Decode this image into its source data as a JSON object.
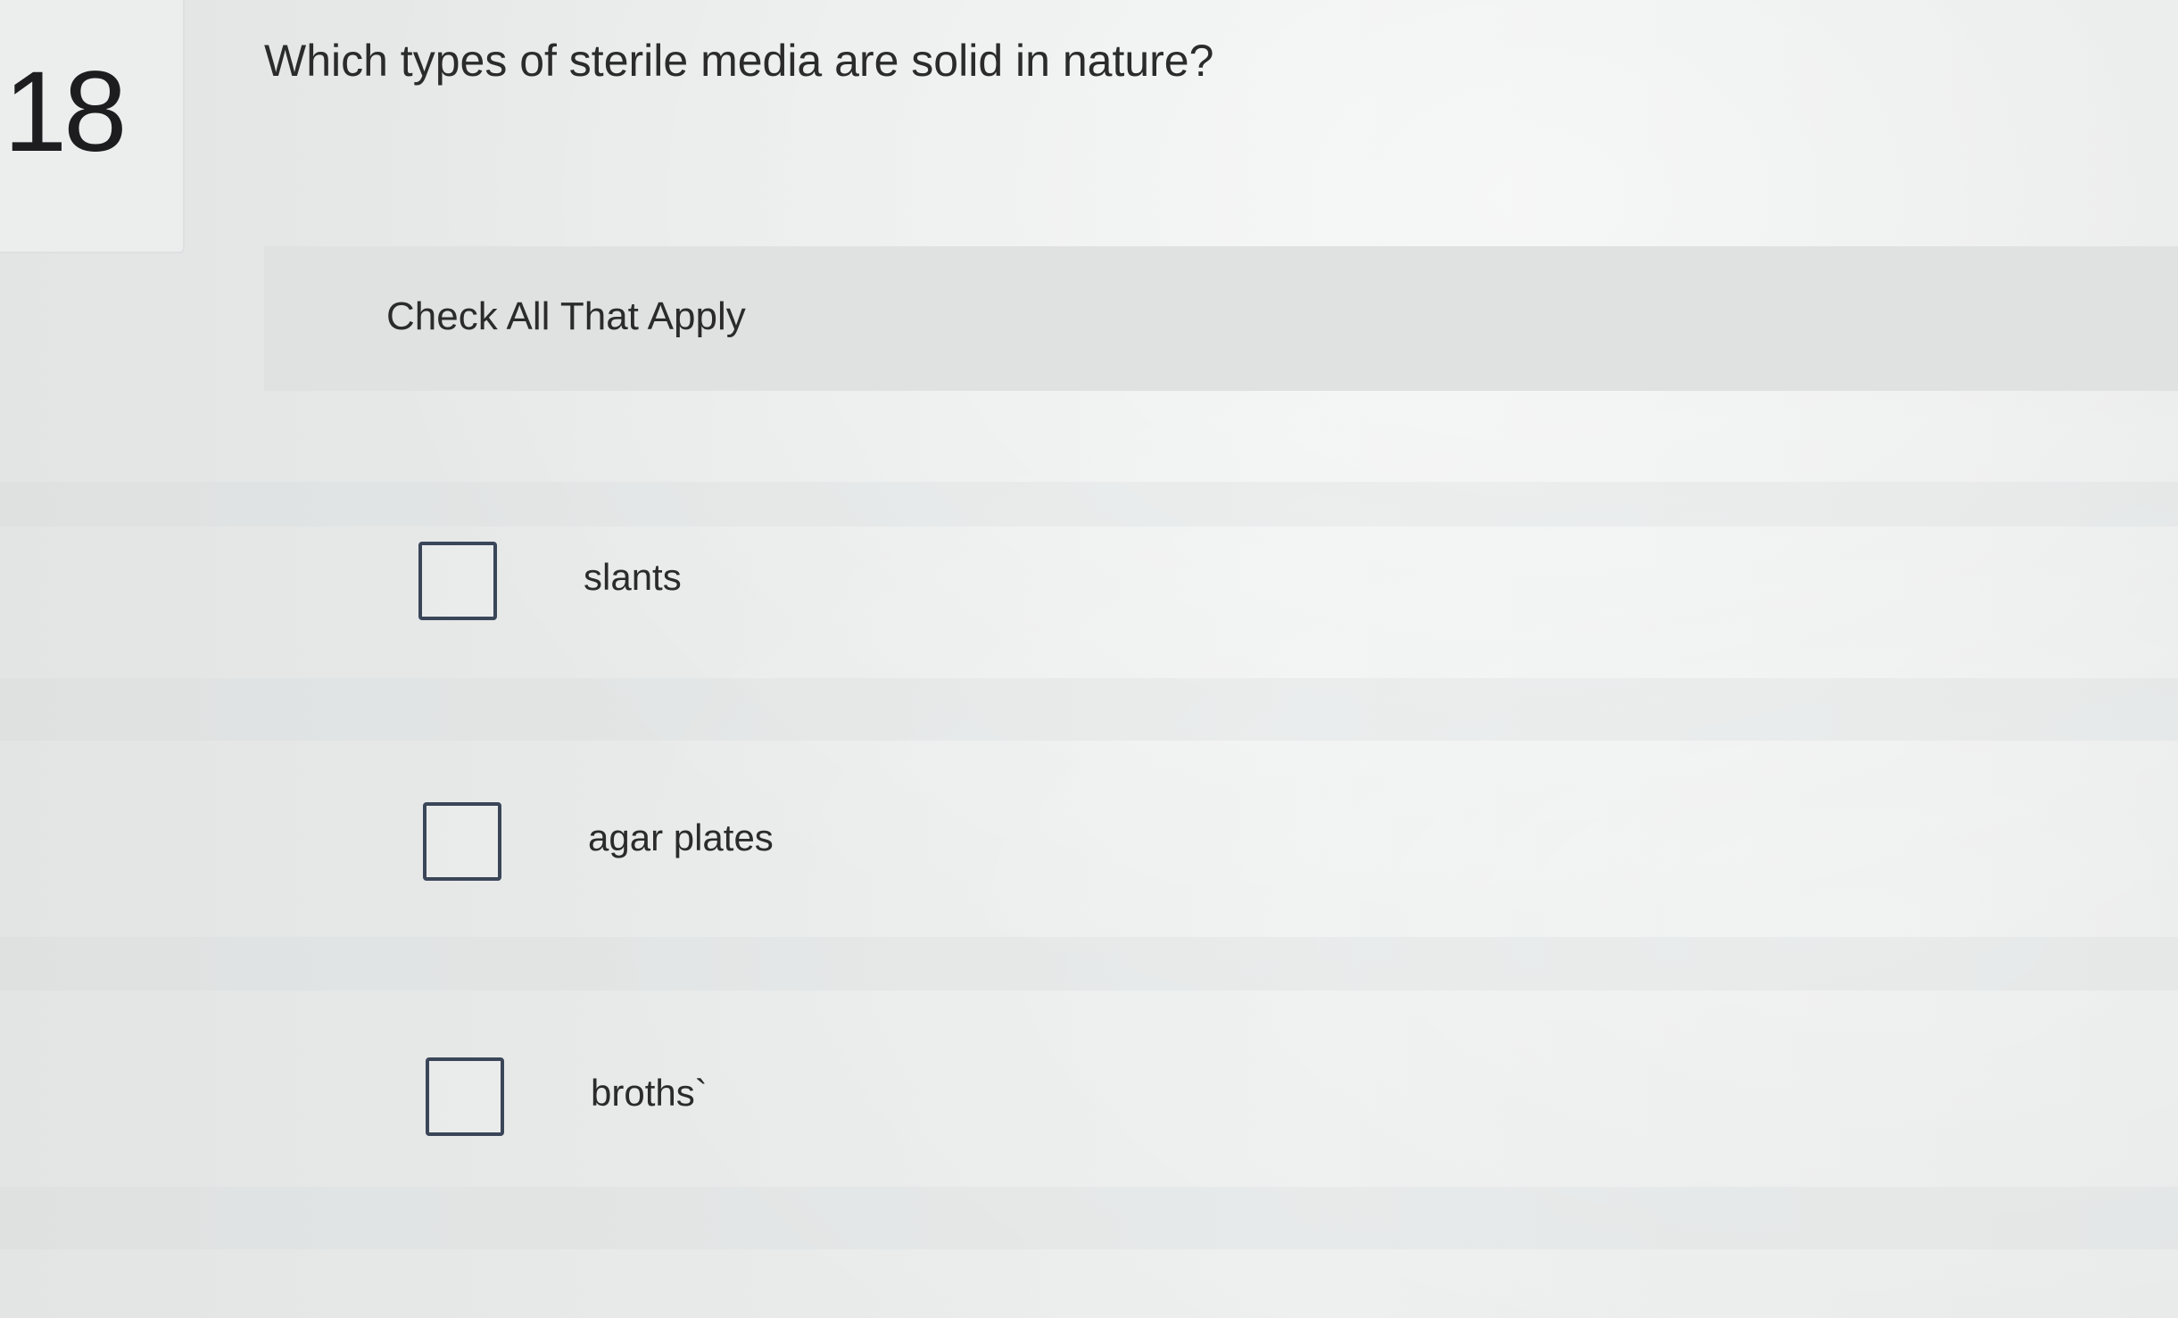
{
  "question": {
    "number": "18",
    "text": "Which types of sterile media are solid in nature?"
  },
  "instruction": "Check All That Apply",
  "options": [
    {
      "label": "slants",
      "checked": false
    },
    {
      "label": "agar plates",
      "checked": false
    },
    {
      "label": "broths`",
      "checked": false
    }
  ]
}
